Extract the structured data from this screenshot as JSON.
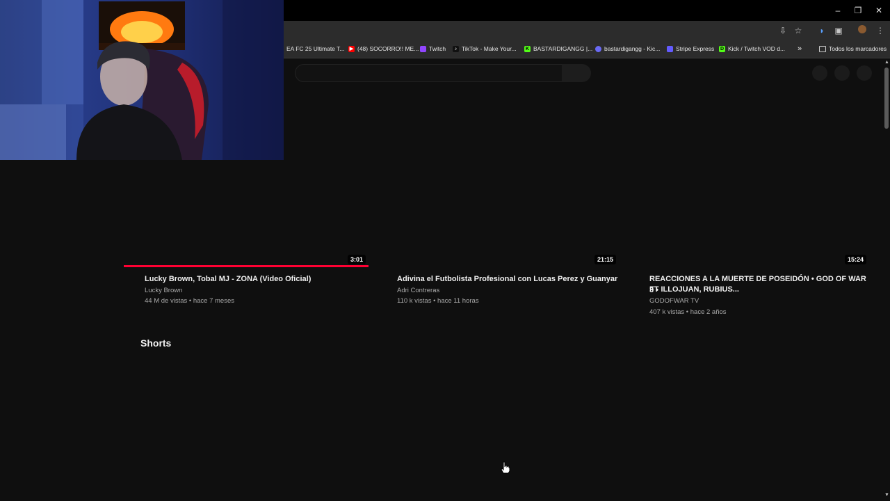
{
  "bookmarks": [
    {
      "label": "EA FC 25 Ultimate T...",
      "icon": "ea-icon",
      "color": "#2c2c2c"
    },
    {
      "label": "(48) SOCORRO!! ME...",
      "icon": "youtube-icon",
      "color": "#ff0000"
    },
    {
      "label": "Twitch",
      "icon": "twitch-icon",
      "color": "#9146ff"
    },
    {
      "label": "TikTok - Make Your...",
      "icon": "tiktok-icon",
      "color": "#111111"
    },
    {
      "label": "BASTARDIGANGG |...",
      "icon": "kick-icon",
      "color": "#53fc18"
    },
    {
      "label": "bastardigangg - Kic...",
      "icon": "link-icon",
      "color": "#6a6af5"
    },
    {
      "label": "Stripe Express",
      "icon": "stripe-icon",
      "color": "#635bff"
    },
    {
      "label": "Kick / Twitch VOD d...",
      "icon": "kick-d-icon",
      "color": "#53fc18"
    }
  ],
  "bookmarks_more": "»",
  "all_bookmarks": "Todos los marcadores",
  "videos": [
    {
      "title": "Lucky Brown, Tobal MJ - ZONA (Video Oficial)",
      "channel": "Lucky Brown",
      "meta": "44 M de vistas • hace 7 meses",
      "duration": "3:01",
      "watched_fraction": 1.0
    },
    {
      "title": "Adivina el Futbolista Profesional con Lucas Perez y Guanyar",
      "channel": "Adri Contreras",
      "meta": "110 k vistas • hace 11 horas",
      "duration": "21:15"
    },
    {
      "title_line1": "REACCIONES A LA MUERTE DE POSEIDÓN • GOD OF WAR 3 •",
      "title_line2": "FT ILLOJUAN, RUBIUS...",
      "channel": "GODOFWAR TV",
      "meta": "407 k vistas • hace 2 años",
      "duration": "15:24"
    }
  ],
  "shorts_title": "Shorts",
  "colors": {
    "progress": "#ff0033",
    "background": "#0f0f0f"
  }
}
